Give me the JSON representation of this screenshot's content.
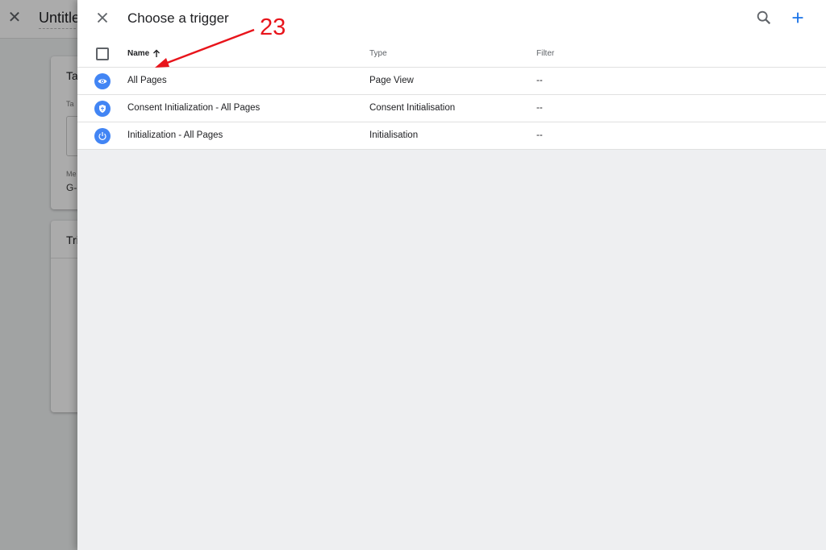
{
  "background": {
    "title": "Untitle",
    "card1_title": "Ta",
    "card1_field_label": "Ta",
    "card1_meta_label": "Me",
    "card1_value": "G-",
    "card2_title": "Tri"
  },
  "panel": {
    "title": "Choose a trigger"
  },
  "table": {
    "headers": {
      "name": "Name",
      "type": "Type",
      "filter": "Filter"
    },
    "sort_icon": "arrow-up-icon",
    "rows": [
      {
        "name": "All Pages",
        "type": "Page View",
        "filter": "--",
        "icon": "eye-icon"
      },
      {
        "name": "Consent Initialization - All Pages",
        "type": "Consent Initialisation",
        "filter": "--",
        "icon": "shield-icon"
      },
      {
        "name": "Initialization - All Pages",
        "type": "Initialisation",
        "filter": "--",
        "icon": "power-icon"
      }
    ]
  },
  "annotation": {
    "number": "23",
    "color": "#e8141b"
  },
  "colors": {
    "accent": "#1a73e8",
    "icon_bg": "#4285f4"
  }
}
